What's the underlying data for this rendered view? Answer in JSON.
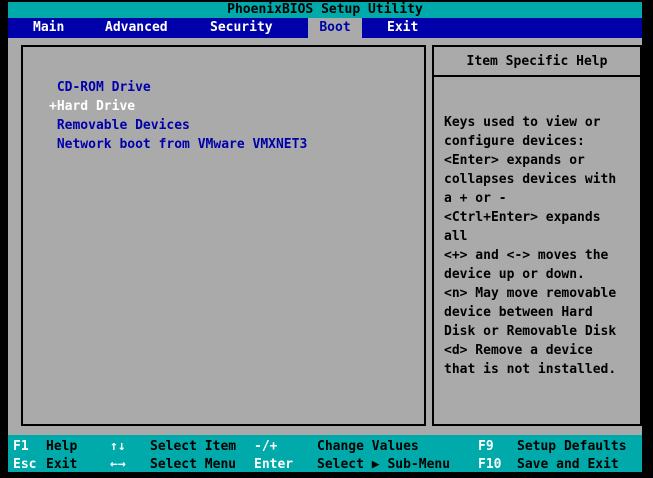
{
  "title": "PhoenixBIOS Setup Utility",
  "colors": {
    "teal": "#00AAAA",
    "menu_blue": "#0000AA",
    "body_gray": "#AAAAAA",
    "item_blue": "#0000AA",
    "selected_white": "#FFFFFF",
    "black": "#000000"
  },
  "menu": {
    "tabs": [
      {
        "label": "Main",
        "active": false
      },
      {
        "label": "Advanced",
        "active": false
      },
      {
        "label": "Security",
        "active": false
      },
      {
        "label": "Boot",
        "active": true
      },
      {
        "label": "Exit",
        "active": false
      }
    ]
  },
  "boot": {
    "items": [
      {
        "prefix": " ",
        "label": "CD-ROM Drive",
        "selected": false
      },
      {
        "prefix": "+",
        "label": "Hard Drive",
        "selected": true
      },
      {
        "prefix": " ",
        "label": "Removable Devices",
        "selected": false
      },
      {
        "prefix": " ",
        "label": "Network boot from VMware VMXNET3",
        "selected": false
      }
    ]
  },
  "help": {
    "title": "Item Specific Help",
    "lines": [
      "Keys used to view or",
      "configure devices:",
      "<Enter> expands or",
      "collapses devices with",
      "a + or -",
      "<Ctrl+Enter> expands",
      "all",
      "<+> and <-> moves the",
      "device up or down.",
      "<n> May move removable",
      "device between Hard",
      "Disk or Removable Disk",
      "<d> Remove a device",
      "that is not installed."
    ]
  },
  "footer": {
    "rows": [
      {
        "items": [
          {
            "key": "F1",
            "label": "Help"
          },
          {
            "key": "↑↓",
            "label": "Select Item"
          },
          {
            "key": "-/+",
            "label": "Change Values"
          },
          {
            "key": "F9",
            "label": "Setup Defaults"
          }
        ]
      },
      {
        "items": [
          {
            "key": "Esc",
            "label": "Exit"
          },
          {
            "key": "←→",
            "label": "Select Menu"
          },
          {
            "key": "Enter",
            "label": "Select ▶ Sub-Menu"
          },
          {
            "key": "F10",
            "label": "Save and Exit"
          }
        ]
      }
    ]
  }
}
